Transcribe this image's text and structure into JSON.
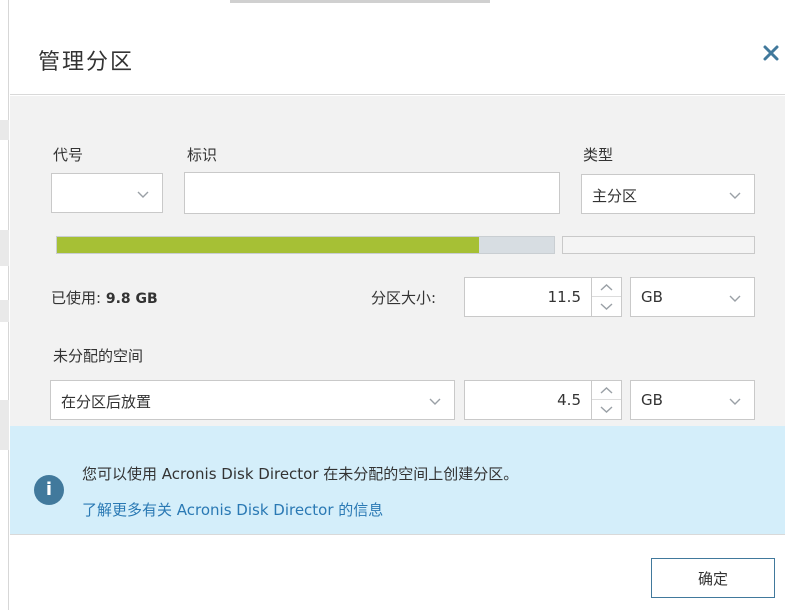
{
  "dialog": {
    "title": "管理分区"
  },
  "form": {
    "code_label": "代号",
    "code_value": "",
    "identity_label": "标识",
    "identity_value": "",
    "type_label": "类型",
    "type_value": "主分区"
  },
  "usage": {
    "used_label": "已使用:",
    "used_value": "9.8 GB",
    "used_fraction": 0.85
  },
  "partition_size": {
    "label": "分区大小:",
    "value": "11.5",
    "unit": "GB"
  },
  "unallocated": {
    "label": "未分配的空间",
    "placement": "在分区后放置",
    "value": "4.5",
    "unit": "GB"
  },
  "info": {
    "message": "您可以使用 Acronis Disk Director 在未分配的空间上创建分区。",
    "link": "了解更多有关 Acronis Disk Director 的信息"
  },
  "footer": {
    "ok_label": "确定"
  },
  "colors": {
    "usage_fill": "#a6c035",
    "info_band": "#d4eefa",
    "accent": "#41799c",
    "link": "#2a79b4"
  }
}
